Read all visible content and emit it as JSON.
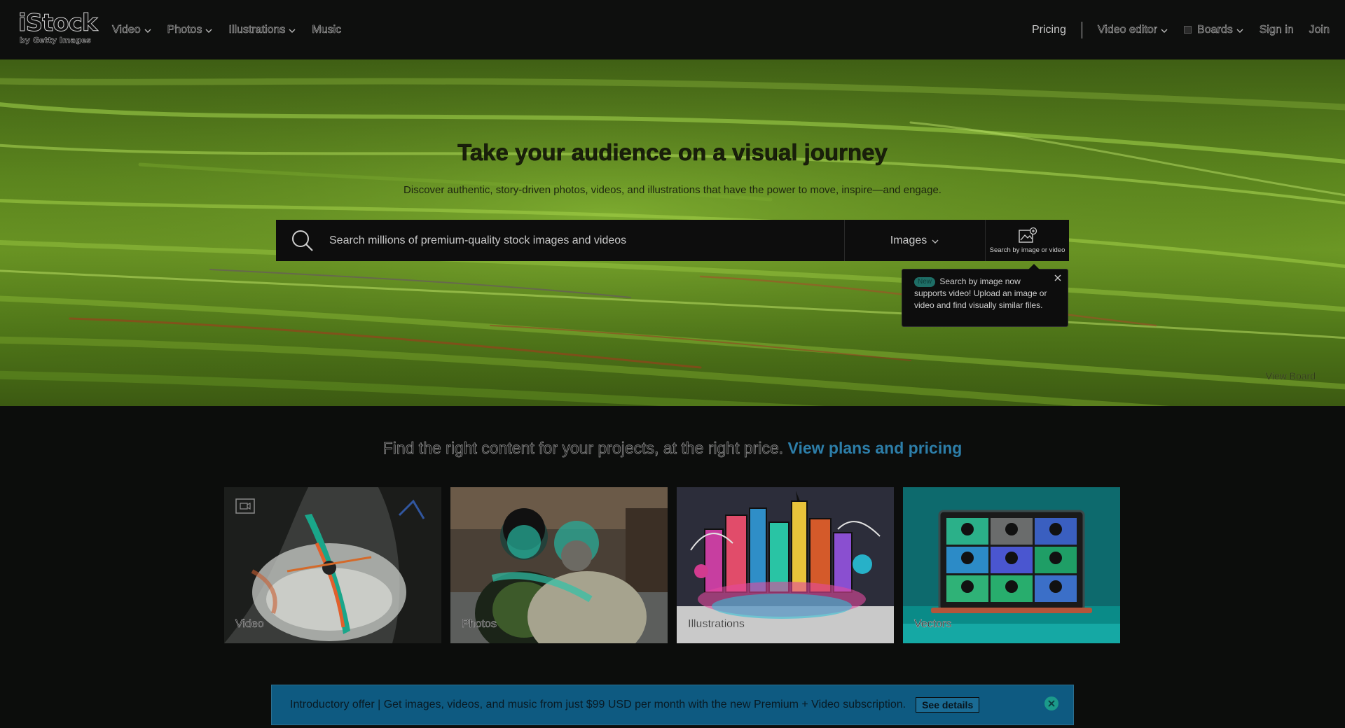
{
  "brand": {
    "wordmark": "iStock",
    "sub": "by Getty Images"
  },
  "nav": {
    "left": [
      {
        "label": "Video",
        "has_dropdown": true
      },
      {
        "label": "Photos",
        "has_dropdown": true
      },
      {
        "label": "Illustrations",
        "has_dropdown": true
      },
      {
        "label": "Music",
        "has_dropdown": false
      }
    ],
    "pricing": "Pricing",
    "video_editor": "Video editor",
    "boards": "Boards",
    "sign_in": "Sign in",
    "join": "Join"
  },
  "hero": {
    "title": "Take your audience on a visual journey",
    "subtitle": "Discover authentic, story-driven photos, videos, and illustrations that have the power to move, inspire—and engage.",
    "search_placeholder": "Search millions of premium-quality stock images and videos",
    "media_type": "Images",
    "image_search_label": "Search by image or video",
    "tooltip": {
      "badge": "New",
      "text": "Search by image now supports video! Upload an image or video and find visually similar files."
    },
    "view_board": "View Board"
  },
  "pricing": {
    "text": "Find the right content for your projects, at the right price.",
    "link": "View plans and pricing"
  },
  "cards": [
    {
      "label": "Video",
      "icon": "camera-icon"
    },
    {
      "label": "Photos"
    },
    {
      "label": "Illustrations"
    },
    {
      "label": "Vectors"
    }
  ],
  "offer": {
    "text": "Introductory offer | Get images, videos, and music from just $99 USD per month with the new Premium + Video subscription.",
    "button": "See details"
  },
  "colors": {
    "link": "#2d7ea9",
    "offer_bg": "#0e5a81",
    "nav_bg": "#0e0f0e",
    "hero_green": "#6e9a25"
  }
}
